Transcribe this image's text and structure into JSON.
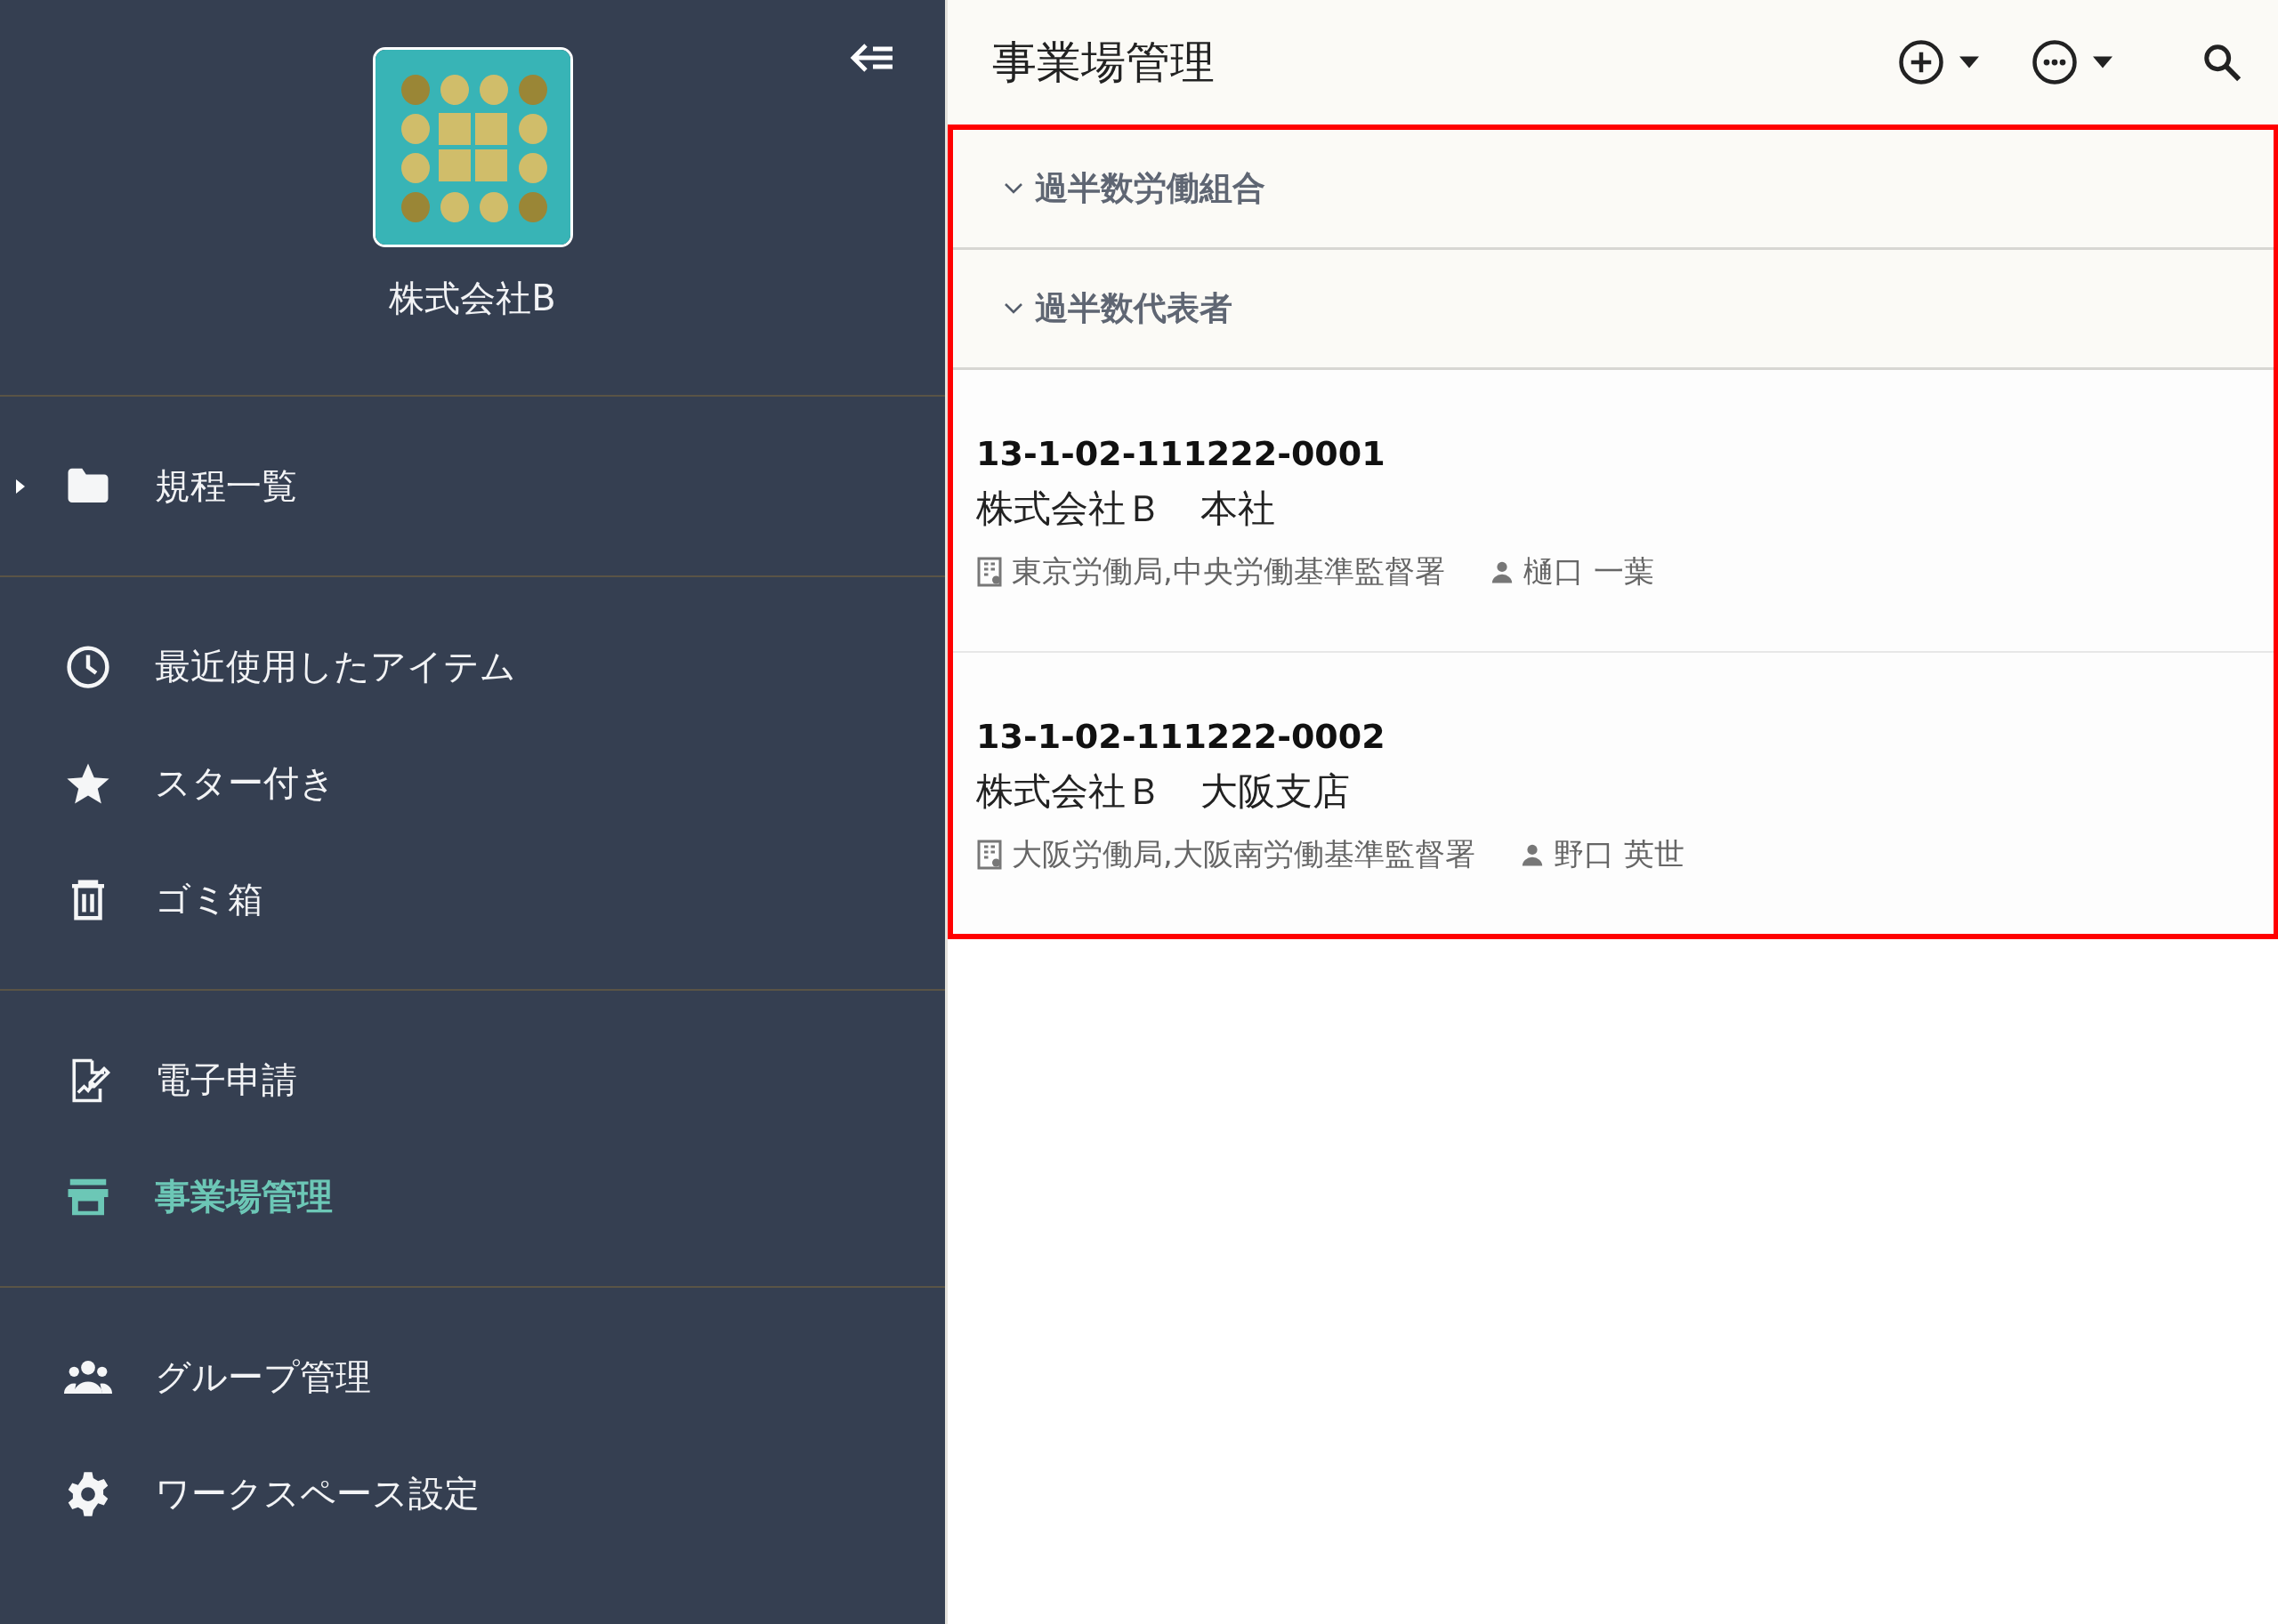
{
  "sidebar": {
    "workspace_name": "株式会社B",
    "sections": [
      {
        "items": [
          {
            "label": "規程一覧",
            "expanded": false,
            "selected": false
          }
        ]
      },
      {
        "items": [
          {
            "label": "最近使用したアイテム",
            "selected": false
          },
          {
            "label": "スター付き",
            "selected": false
          },
          {
            "label": "ゴミ箱",
            "selected": false
          }
        ]
      },
      {
        "items": [
          {
            "label": "電子申請",
            "selected": false
          },
          {
            "label": "事業場管理",
            "selected": true
          }
        ]
      },
      {
        "items": [
          {
            "label": "グループ管理",
            "selected": false
          },
          {
            "label": "ワークスペース設定",
            "selected": false
          }
        ]
      }
    ]
  },
  "header": {
    "title": "事業場管理"
  },
  "groups": [
    {
      "label": "過半数労働組合",
      "expanded": true
    },
    {
      "label": "過半数代表者",
      "expanded": true
    }
  ],
  "entries": [
    {
      "id": "13-1-02-111222-0001",
      "name": "株式会社Ｂ　本社",
      "office": "東京労働局,中央労働基準監督署",
      "person": "樋口 一葉"
    },
    {
      "id": "13-1-02-111222-0002",
      "name": "株式会社Ｂ　大阪支店",
      "office": "大阪労働局,大阪南労働基準監督署",
      "person": "野口 英世"
    }
  ]
}
